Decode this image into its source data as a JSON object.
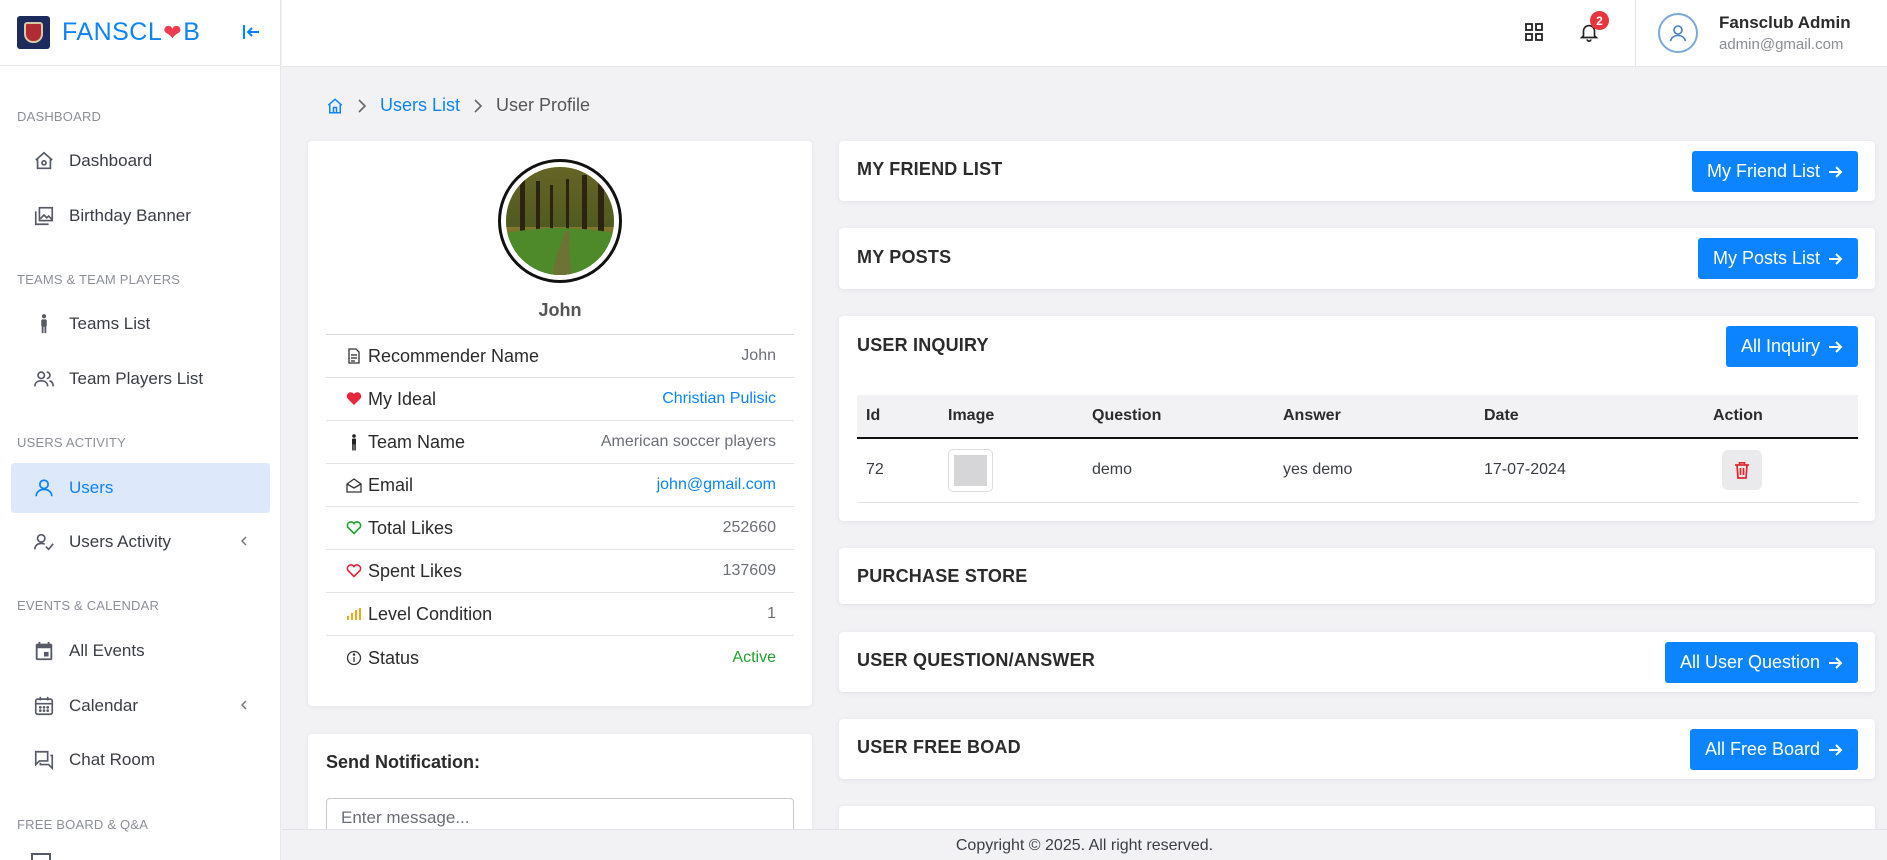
{
  "brand": {
    "name_part1": "FANSCL",
    "name_part2": "B",
    "heart": "❤"
  },
  "sidebar": {
    "sections": [
      {
        "title": "DASHBOARD"
      },
      {
        "title": "TEAMS & TEAM PLAYERS"
      },
      {
        "title": "USERS ACTIVITY"
      },
      {
        "title": "EVENTS & CALENDAR"
      },
      {
        "title": "FREE BOARD & Q&A"
      }
    ],
    "items": [
      {
        "label": "Dashboard",
        "icon": "home-icon"
      },
      {
        "label": "Birthday Banner",
        "icon": "images-icon"
      },
      {
        "label": "Teams List",
        "icon": "person-standing-icon"
      },
      {
        "label": "Team Players List",
        "icon": "users-icon"
      },
      {
        "label": "Users",
        "icon": "user-icon",
        "active": true
      },
      {
        "label": "Users Activity",
        "icon": "user-check-icon"
      },
      {
        "label": "All Events",
        "icon": "calendar-event-icon"
      },
      {
        "label": "Calendar",
        "icon": "calendar-icon"
      },
      {
        "label": "Chat Room",
        "icon": "chat-icon"
      }
    ]
  },
  "header": {
    "notification_count": "2",
    "user_name": "Fansclub Admin",
    "user_email": "admin@gmail.com"
  },
  "breadcrumb": {
    "users_list": "Users List",
    "current": "User Profile"
  },
  "profile": {
    "name": "John",
    "rows": [
      {
        "label": "Recommender Name",
        "value": "John",
        "icon": "document-icon"
      },
      {
        "label": "My Ideal",
        "value": "Christian Pulisic",
        "icon": "heart-filled-icon"
      },
      {
        "label": "Team Name",
        "value": "American soccer players",
        "icon": "person-standing-icon"
      },
      {
        "label": "Email",
        "value": "john@gmail.com",
        "icon": "envelope-open-icon"
      },
      {
        "label": "Total Likes",
        "value": "252660",
        "icon": "heart-green-icon"
      },
      {
        "label": "Spent Likes",
        "value": "137609",
        "icon": "heart-red-icon"
      },
      {
        "label": "Level Condition",
        "value": "1",
        "icon": "signal-bars-icon"
      },
      {
        "label": "Status",
        "value": "Active",
        "icon": "info-circle-icon"
      }
    ]
  },
  "notification": {
    "title": "Send Notification:",
    "placeholder": "Enter message..."
  },
  "panels": {
    "friends": {
      "title": "MY FRIEND LIST",
      "button": "My Friend List"
    },
    "posts": {
      "title": "MY POSTS",
      "button": "My Posts List"
    },
    "inquiry": {
      "title": "USER INQUIRY",
      "button": "All Inquiry",
      "columns": [
        "Id",
        "Image",
        "Question",
        "Answer",
        "Date",
        "Action"
      ],
      "rows": [
        {
          "id": "72",
          "question": "demo",
          "answer": "yes demo",
          "date": "17-07-2024"
        }
      ]
    },
    "store": {
      "title": "PURCHASE STORE"
    },
    "qa": {
      "title": "USER QUESTION/ANSWER",
      "button": "All User Question"
    },
    "freeboard": {
      "title": "USER FREE BOAD",
      "button": "All Free Board"
    }
  },
  "footer": {
    "text": "Copyright © 2025. All right reserved."
  },
  "colors": {
    "primary": "#0d84ff",
    "danger": "#e0262f",
    "success": "#1fa22e",
    "active_bg": "#dde9fb"
  }
}
